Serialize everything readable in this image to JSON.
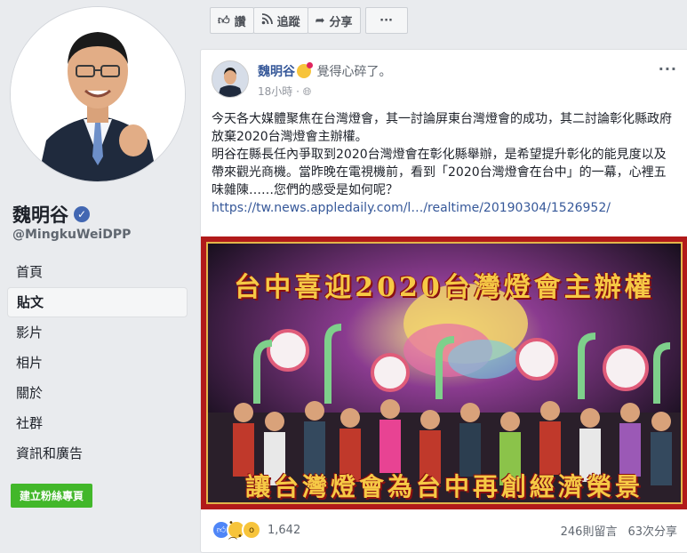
{
  "page": {
    "name": "魏明谷",
    "handle": "@MingkuWeiDPP"
  },
  "nav": {
    "items": [
      "首頁",
      "貼文",
      "影片",
      "相片",
      "關於",
      "社群",
      "資訊和廣告"
    ],
    "active": "貼文",
    "create_button": "建立粉絲專頁"
  },
  "actionbar": {
    "like": "讚",
    "follow": "追蹤",
    "share": "分享",
    "more": "···"
  },
  "post": {
    "author": "魏明谷",
    "feeling": "覺得心碎了。",
    "time": "18小時",
    "text": [
      "今天各大媒體聚焦在台灣燈會，其一討論屏東台灣燈會的成功，其二討論彰化縣政府放棄2020台灣燈會主辦權。",
      "明谷在縣長任內爭取到2020台灣燈會在彰化縣舉辦，是希望提升彰化的能見度以及帶來觀光商機。當昨晚在電視機前，看到「2020台灣燈會在台中」的一幕，心裡五味雜陳……您們的感受是如何呢？"
    ],
    "link": "https://tw.news.appledaily.com/l…/realtime/20190304/1526952/",
    "image": {
      "top_banner": "台中喜迎2020台灣燈會主辦權",
      "bottom_banner": "讓台灣燈會為台中再創經濟榮景"
    },
    "reactions_count": "1,642",
    "comments": "246則留言",
    "shares": "63次分享"
  },
  "colors": {
    "link": "#365899",
    "create_button": "#42b72a",
    "banner_text": "#f6c945",
    "frame": "#b11a1a"
  }
}
